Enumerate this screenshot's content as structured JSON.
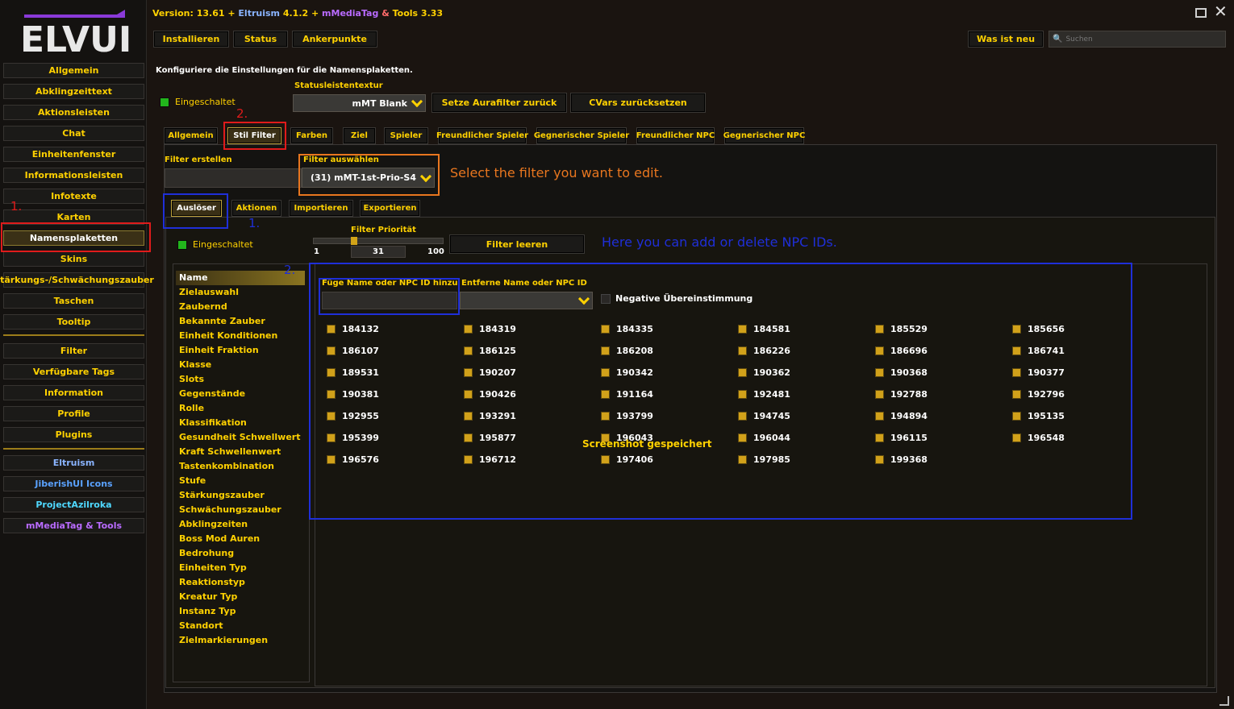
{
  "app": {
    "logo": "ELVUI",
    "version_parts": [
      {
        "text": "Version: 13.61 + ",
        "color": "#ffd100"
      },
      {
        "text": "Eltruism",
        "color": "#8ab4ff"
      },
      {
        "text": " 4.1.2 + ",
        "color": "#ffd100"
      },
      {
        "text": "mMediaTag",
        "color": "#b96bff"
      },
      {
        "text": " & ",
        "color": "#ff6b6b"
      },
      {
        "text": "Tools 3.33",
        "color": "#ffd100"
      }
    ]
  },
  "topbar": {
    "install": "Installieren",
    "status": "Status",
    "anchors": "Ankerpunkte",
    "whatsnew": "Was ist neu",
    "search_placeholder": "Suchen"
  },
  "sidebar": {
    "items": [
      "Allgemein",
      "Abklingzeittext",
      "Aktionsleisten",
      "Chat",
      "Einheitenfenster",
      "Informationsleisten",
      "Infotexte",
      "Karten",
      "Namensplaketten",
      "Skins",
      "Stärkungs-/Schwächungszauber",
      "Taschen",
      "Tooltip"
    ],
    "items2": [
      "Filter",
      "Verfügbare Tags",
      "Information",
      "Profile",
      "Plugins"
    ],
    "plugins": [
      "Eltruism",
      "JiberishUI Icons",
      "ProjectAzilroka",
      "mMediaTag & Tools"
    ],
    "active": "Namensplaketten"
  },
  "main": {
    "description": "Konfiguriere die Einstellungen für die Namensplaketten.",
    "enabled_label": "Eingeschaltet",
    "statusbar_texture_label": "Statusleistentextur",
    "statusbar_texture_value": "mMT Blank",
    "reset_aura_filter": "Setze Aurafilter zurück",
    "reset_cvars": "CVars zurücksetzen",
    "tabs": [
      "Allgemein",
      "Stil Filter",
      "Farben",
      "Ziel",
      "Spieler",
      "Freundlicher Spieler",
      "Gegnerischer Spieler",
      "Freundlicher NPC",
      "Gegnerischer NPC"
    ],
    "active_tab": "Stil Filter",
    "create_filter_label": "Filter erstellen",
    "select_filter_label": "Filter auswählen",
    "select_filter_value": "(31) mMT-1st-Prio-S4",
    "subtabs": [
      "Auslöser",
      "Aktionen",
      "Importieren",
      "Exportieren"
    ],
    "active_subtab": "Auslöser",
    "sub_enabled_label": "Eingeschaltet",
    "priority_label": "Filter Priorität",
    "priority_min": "1",
    "priority_value": "31",
    "priority_max": "100",
    "clear_filter": "Filter leeren",
    "trigger_list": [
      "Name",
      "Zielauswahl",
      "Zaubernd",
      "Bekannte Zauber",
      "Einheit Konditionen",
      "Einheit Fraktion",
      "Klasse",
      "Slots",
      "Gegenstände",
      "Rolle",
      "Klassifikation",
      "Gesundheit Schwellwert",
      "Kraft Schwellenwert",
      "Tastenkombination",
      "Stufe",
      "Stärkungszauber",
      "Schwächungszauber",
      "Abklingzeiten",
      "Boss Mod Auren",
      "Bedrohung",
      "Einheiten Typ",
      "Reaktionstyp",
      "Kreatur Typ",
      "Instanz Typ",
      "Standort",
      "Zielmarkierungen"
    ],
    "add_label": "Füge Name oder NPC ID hinzu",
    "remove_label": "Entferne Name oder NPC ID",
    "negative_match": "Negative Übereinstimmung",
    "npc_ids": [
      "184132",
      "184319",
      "184335",
      "184581",
      "185529",
      "185656",
      "186107",
      "186125",
      "186208",
      "186226",
      "186696",
      "186741",
      "189531",
      "190207",
      "190342",
      "190362",
      "190368",
      "190377",
      "190381",
      "190426",
      "191164",
      "192481",
      "192788",
      "192796",
      "192955",
      "193291",
      "193799",
      "194745",
      "194894",
      "195135",
      "195399",
      "195877",
      "196043",
      "196044",
      "196115",
      "196548",
      "196576",
      "196712",
      "197406",
      "197985",
      "199368"
    ],
    "screenshot_toast": "Screenshot gespeichert"
  },
  "annotations": {
    "num1_red": "1.",
    "num2_red": "2.",
    "num1_blue": "1.",
    "num2_blue": "2.",
    "select_hint": "Select the filter you want to edit.",
    "npc_hint": "Here you can add or delete NPC IDs."
  }
}
